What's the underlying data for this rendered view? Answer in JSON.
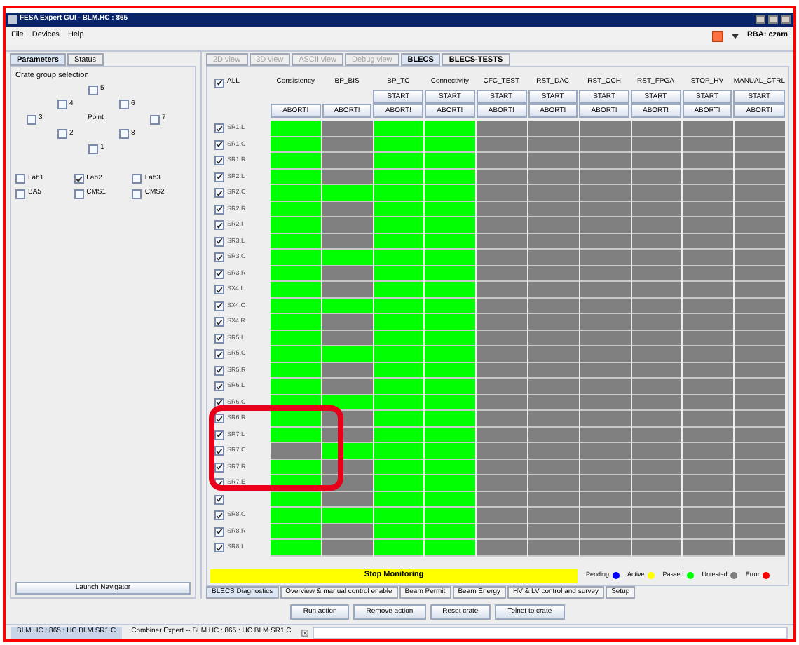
{
  "window": {
    "title": "FESA Expert GUI - BLM.HC : 865",
    "user": "RBA: czam"
  },
  "menu": [
    "File",
    "Devices",
    "Help"
  ],
  "left_panel": {
    "tabs": [
      {
        "label": "Parameters",
        "selected": true
      },
      {
        "label": "Status",
        "selected": false
      }
    ],
    "group_title": "Crate group selection",
    "point_label": "Point",
    "points": [
      {
        "label": "5",
        "checked": false
      },
      {
        "label": "4",
        "checked": false
      },
      {
        "label": "6",
        "checked": false
      },
      {
        "label": "3",
        "checked": false
      },
      {
        "label": "7",
        "checked": false
      },
      {
        "label": "2",
        "checked": false
      },
      {
        "label": "8",
        "checked": false
      },
      {
        "label": "1",
        "checked": false
      }
    ],
    "labs": [
      {
        "label": "Lab1",
        "checked": false
      },
      {
        "label": "Lab2",
        "checked": true
      },
      {
        "label": "Lab3",
        "checked": false
      },
      {
        "label": "BA5",
        "checked": false
      },
      {
        "label": "CMS1",
        "checked": false
      },
      {
        "label": "CMS2",
        "checked": false
      }
    ],
    "launch_button": "Launch Navigator"
  },
  "view_tabs": [
    {
      "label": "2D view",
      "selected": false,
      "disabled": true
    },
    {
      "label": "3D view",
      "selected": false,
      "disabled": true
    },
    {
      "label": "ASCII view",
      "selected": false,
      "disabled": true
    },
    {
      "label": "Debug view",
      "selected": false,
      "disabled": true
    },
    {
      "label": "BLECS",
      "selected": true,
      "disabled": false
    },
    {
      "label": "BLECS-TESTS",
      "selected": false,
      "disabled": false
    }
  ],
  "grid": {
    "all_label": "ALL",
    "all_checked": true,
    "columns": [
      {
        "name": "Consistency",
        "buttons": [
          "ABORT!"
        ]
      },
      {
        "name": "BP_BIS",
        "buttons": [
          "ABORT!"
        ]
      },
      {
        "name": "BP_TC",
        "buttons": [
          "START",
          "ABORT!"
        ]
      },
      {
        "name": "Connectivity",
        "buttons": [
          "START",
          "ABORT!"
        ]
      },
      {
        "name": "CFC_TEST",
        "buttons": [
          "START",
          "ABORT!"
        ]
      },
      {
        "name": "RST_DAC",
        "buttons": [
          "START",
          "ABORT!"
        ]
      },
      {
        "name": "RST_OCH",
        "buttons": [
          "START",
          "ABORT!"
        ]
      },
      {
        "name": "RST_FPGA",
        "buttons": [
          "START",
          "ABORT!"
        ]
      },
      {
        "name": "STOP_HV",
        "buttons": [
          "START",
          "ABORT!"
        ]
      },
      {
        "name": "MANUAL_CTRL",
        "buttons": [
          "START",
          "ABORT!"
        ]
      }
    ],
    "rows": [
      {
        "label": "SR1.L",
        "checked": true,
        "passed": [
          true,
          false,
          true,
          true,
          false,
          false,
          false,
          false,
          false,
          false
        ]
      },
      {
        "label": "SR1.C",
        "checked": true,
        "passed": [
          true,
          false,
          true,
          true,
          false,
          false,
          false,
          false,
          false,
          false
        ]
      },
      {
        "label": "SR1.R",
        "checked": true,
        "passed": [
          true,
          false,
          true,
          true,
          false,
          false,
          false,
          false,
          false,
          false
        ]
      },
      {
        "label": "SR2.L",
        "checked": true,
        "passed": [
          true,
          false,
          true,
          true,
          false,
          false,
          false,
          false,
          false,
          false
        ]
      },
      {
        "label": "SR2.C",
        "checked": true,
        "passed": [
          true,
          true,
          true,
          true,
          false,
          false,
          false,
          false,
          false,
          false
        ]
      },
      {
        "label": "SR2.R",
        "checked": true,
        "passed": [
          true,
          false,
          true,
          true,
          false,
          false,
          false,
          false,
          false,
          false
        ]
      },
      {
        "label": "SR2.I",
        "checked": true,
        "passed": [
          true,
          false,
          true,
          true,
          false,
          false,
          false,
          false,
          false,
          false
        ]
      },
      {
        "label": "SR3.L",
        "checked": true,
        "passed": [
          true,
          false,
          true,
          true,
          false,
          false,
          false,
          false,
          false,
          false
        ]
      },
      {
        "label": "SR3.C",
        "checked": true,
        "passed": [
          true,
          true,
          true,
          true,
          false,
          false,
          false,
          false,
          false,
          false
        ]
      },
      {
        "label": "SR3.R",
        "checked": true,
        "passed": [
          true,
          false,
          true,
          true,
          false,
          false,
          false,
          false,
          false,
          false
        ]
      },
      {
        "label": "SX4.L",
        "checked": true,
        "passed": [
          true,
          false,
          true,
          true,
          false,
          false,
          false,
          false,
          false,
          false
        ]
      },
      {
        "label": "SX4.C",
        "checked": true,
        "passed": [
          true,
          true,
          true,
          true,
          false,
          false,
          false,
          false,
          false,
          false
        ]
      },
      {
        "label": "SX4.R",
        "checked": true,
        "passed": [
          true,
          false,
          true,
          true,
          false,
          false,
          false,
          false,
          false,
          false
        ]
      },
      {
        "label": "SR5.L",
        "checked": true,
        "passed": [
          true,
          false,
          true,
          true,
          false,
          false,
          false,
          false,
          false,
          false
        ]
      },
      {
        "label": "SR5.C",
        "checked": true,
        "passed": [
          true,
          true,
          true,
          true,
          false,
          false,
          false,
          false,
          false,
          false
        ]
      },
      {
        "label": "SR5.R",
        "checked": true,
        "passed": [
          true,
          false,
          true,
          true,
          false,
          false,
          false,
          false,
          false,
          false
        ]
      },
      {
        "label": "SR6.L",
        "checked": true,
        "passed": [
          true,
          false,
          true,
          true,
          false,
          false,
          false,
          false,
          false,
          false
        ]
      },
      {
        "label": "SR6.C",
        "checked": true,
        "passed": [
          true,
          true,
          true,
          true,
          false,
          false,
          false,
          false,
          false,
          false
        ]
      },
      {
        "label": "SR6.R",
        "checked": true,
        "passed": [
          true,
          false,
          true,
          true,
          false,
          false,
          false,
          false,
          false,
          false
        ]
      },
      {
        "label": "SR7.L",
        "checked": true,
        "passed": [
          true,
          false,
          true,
          true,
          false,
          false,
          false,
          false,
          false,
          false
        ]
      },
      {
        "label": "SR7.C",
        "checked": true,
        "passed": [
          false,
          true,
          true,
          true,
          false,
          false,
          false,
          false,
          false,
          false
        ]
      },
      {
        "label": "SR7.R",
        "checked": true,
        "passed": [
          true,
          false,
          true,
          true,
          false,
          false,
          false,
          false,
          false,
          false
        ]
      },
      {
        "label": "SR7.E",
        "checked": true,
        "passed": [
          true,
          false,
          true,
          true,
          false,
          false,
          false,
          false,
          false,
          false
        ]
      },
      {
        "checked": true,
        "passed": [
          true,
          false,
          true,
          true,
          false,
          false,
          false,
          false,
          false,
          false
        ]
      },
      {
        "label": "SR8.C",
        "checked": true,
        "passed": [
          true,
          true,
          true,
          true,
          false,
          false,
          false,
          false,
          false,
          false
        ]
      },
      {
        "label": "SR8.R",
        "checked": true,
        "passed": [
          true,
          false,
          true,
          true,
          false,
          false,
          false,
          false,
          false,
          false
        ]
      },
      {
        "label": "SR8.I",
        "checked": true,
        "passed": [
          true,
          false,
          true,
          true,
          false,
          false,
          false,
          false,
          false,
          false
        ]
      }
    ]
  },
  "monitor_button": "Stop Monitoring",
  "legend": [
    {
      "label": "Pending",
      "color": "#0000ff"
    },
    {
      "label": "Active",
      "color": "#ffff00"
    },
    {
      "label": "Passed",
      "color": "#00ff00"
    },
    {
      "label": "Untested",
      "color": "#808080"
    },
    {
      "label": "Error",
      "color": "#ff0000"
    }
  ],
  "bottom_tabs": [
    {
      "label": "BLECS Diagnostics",
      "selected": true
    },
    {
      "label": "Overview & manual control enable",
      "selected": false
    },
    {
      "label": "Beam Permit",
      "selected": false
    },
    {
      "label": "Beam Energy",
      "selected": false
    },
    {
      "label": "HV & LV control and survey",
      "selected": false
    },
    {
      "label": "Setup",
      "selected": false
    }
  ],
  "actions": [
    "Run action",
    "Remove action",
    "Reset crate",
    "Telnet to crate"
  ],
  "taskbar": [
    {
      "label": "BLM.HC : 865 : HC.BLM.SR1.C",
      "selected": true
    },
    {
      "label": "Combiner Expert -- BLM.HC : 865 : HC.BLM.SR1.C",
      "selected": false
    }
  ]
}
